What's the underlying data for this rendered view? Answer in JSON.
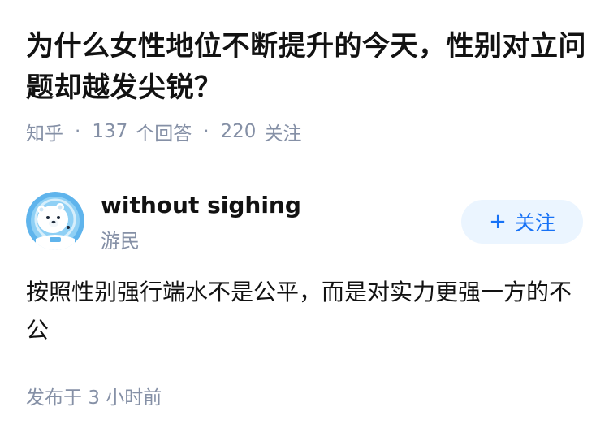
{
  "question": {
    "title": "为什么女性地位不断提升的今天，性别对立问题却越发尖锐？",
    "source": "知乎",
    "separator": "·",
    "answers_count": "137",
    "answers_label": "个回答",
    "followers_count": "220",
    "followers_label": "关注"
  },
  "author": {
    "name": "without sighing",
    "description": "游民",
    "avatar_icon": "polar-bear-astronaut-avatar",
    "follow_button": {
      "plus": "+",
      "label": "关注"
    }
  },
  "answer": {
    "text": "按照性别强行端水不是公平，而是对实力更强一方的不公",
    "published_label": "发布于",
    "published_time": "3 小时前"
  },
  "colors": {
    "text_primary": "#121212",
    "text_secondary": "#8590a6",
    "accent": "#1772f6",
    "follow_bg": "#ebf5ff",
    "avatar_bg": "#5fb4ec"
  }
}
